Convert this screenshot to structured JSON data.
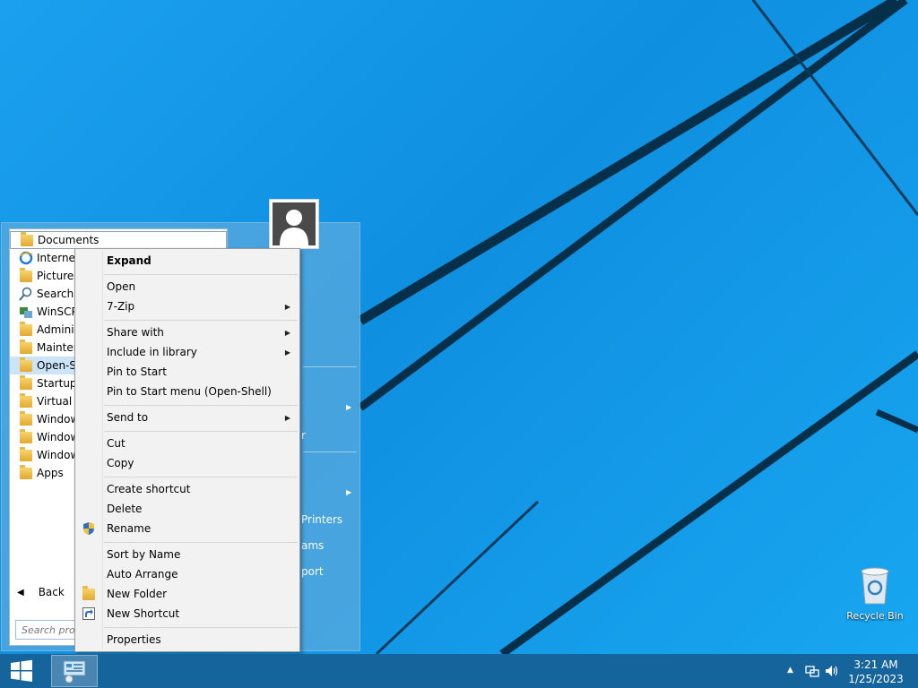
{
  "desktop": {
    "recycle_bin_label": "Recycle Bin"
  },
  "start_menu": {
    "programs": [
      {
        "label": "Documents",
        "icon": "documents-folder-icon"
      },
      {
        "label": "Internet",
        "icon": "internet-explorer-icon"
      },
      {
        "label": "Pictures",
        "icon": "pictures-folder-icon"
      },
      {
        "label": "Search",
        "icon": "search-icon"
      },
      {
        "label": "WinSCP",
        "icon": "winscp-icon"
      },
      {
        "label": "Adminis",
        "icon": "folder-icon"
      },
      {
        "label": "Mainten",
        "icon": "folder-icon"
      },
      {
        "label": "Open-Sh",
        "icon": "folder-icon"
      },
      {
        "label": "Startup",
        "icon": "folder-icon"
      },
      {
        "label": "Virtual A",
        "icon": "folder-icon"
      },
      {
        "label": "Window",
        "icon": "folder-icon"
      },
      {
        "label": "Window",
        "icon": "folder-icon"
      },
      {
        "label": "Window",
        "icon": "folder-icon"
      },
      {
        "label": "Apps",
        "icon": "folder-icon"
      }
    ],
    "back_label": "Back",
    "search_placeholder": "Search prog",
    "right_fragments": [
      "r",
      "Printers",
      "ams",
      "port"
    ]
  },
  "context_menu": {
    "items": [
      {
        "label": "Expand",
        "bold": true
      },
      {
        "label": "Open"
      },
      {
        "label": "7-Zip",
        "submenu": true
      },
      {
        "label": "Share with",
        "submenu": true
      },
      {
        "label": "Include in library",
        "submenu": true
      },
      {
        "label": "Pin to Start"
      },
      {
        "label": "Pin to Start menu (Open-Shell)"
      },
      {
        "label": "Send to",
        "submenu": true
      },
      {
        "label": "Cut"
      },
      {
        "label": "Copy"
      },
      {
        "label": "Create shortcut"
      },
      {
        "label": "Delete"
      },
      {
        "label": "Rename",
        "icon": "uac-shield-icon"
      },
      {
        "label": "Sort by Name"
      },
      {
        "label": "Auto Arrange"
      },
      {
        "label": "New Folder",
        "icon": "folder-icon"
      },
      {
        "label": "New Shortcut",
        "icon": "shortcut-icon"
      },
      {
        "label": "Properties"
      }
    ]
  },
  "taskbar": {
    "time": "3:21 AM",
    "date": "1/25/2023"
  },
  "colors": {
    "desktop_blue": "#1aa0ee",
    "taskbar": "#165f96",
    "selection": "#cce4f7"
  }
}
